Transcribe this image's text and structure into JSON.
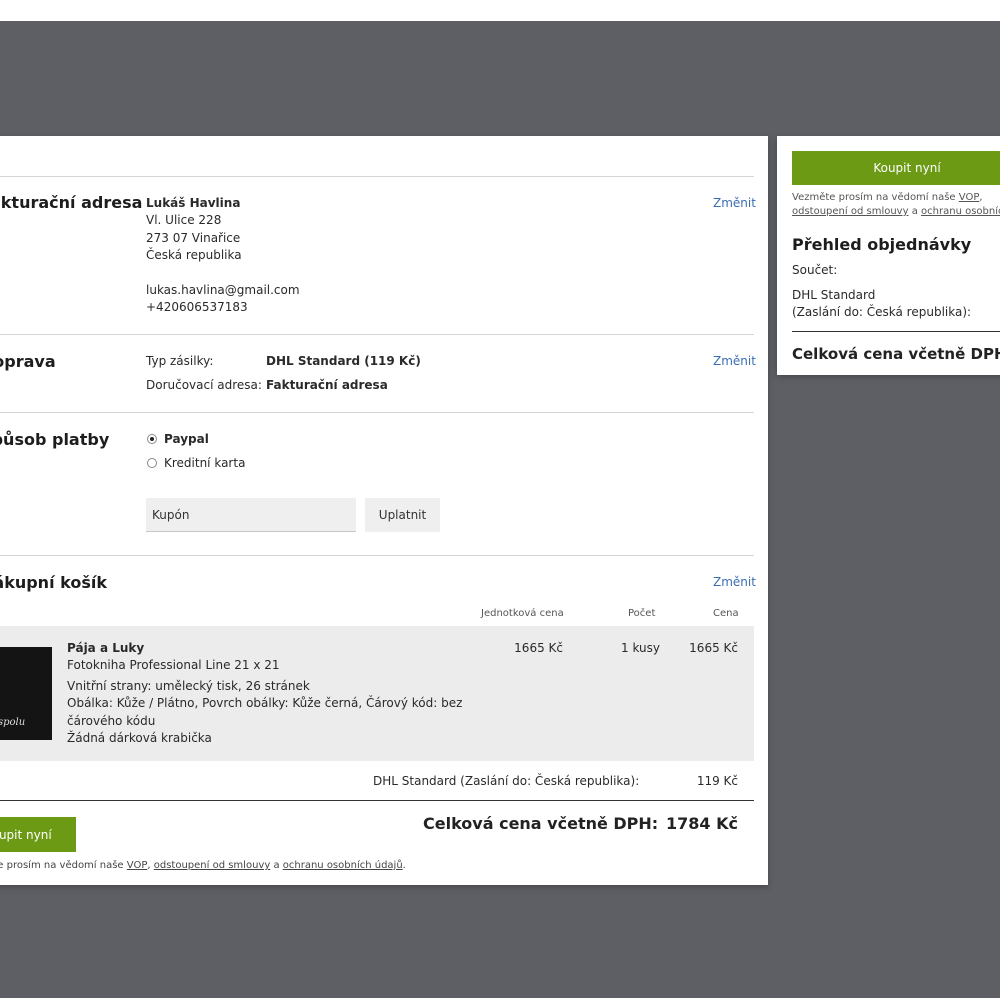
{
  "billing": {
    "title": "Fakturační adresa",
    "change": "Změnit",
    "name": "Lukáš Havlina",
    "street": "Vl. Ulice 228",
    "city": "273 07 Vinařice",
    "country": "Česká republika",
    "email": "lukas.havlina@gmail.com",
    "phone": "+420606537183"
  },
  "shipping": {
    "title": "Doprava",
    "change": "Změnit",
    "type_label": "Typ zásilky:",
    "type_value": "DHL Standard (119 Kč)",
    "address_label": "Doručovací adresa:",
    "address_value": "Fakturační adresa"
  },
  "payment": {
    "title": "Způsob platby",
    "options": [
      {
        "label": "Paypal",
        "selected": true
      },
      {
        "label": "Kreditní karta",
        "selected": false
      }
    ],
    "coupon_placeholder": "Kupón",
    "apply": "Uplatnit"
  },
  "cart": {
    "title": "Nákupní košík",
    "change": "Změnit",
    "headers": {
      "unit_price": "Jednotková cena",
      "count": "Počet",
      "price": "Cena"
    },
    "item": {
      "thumb_text": "spolu",
      "name": "Pája a Luky",
      "product": "Fotokniha Professional Line 21 x 21",
      "line1": "Vnitřní strany: umělecký tisk, 26 stránek",
      "line2": "Obálka: Kůže / Plátno, Povrch obálky: Kůže černá, Čárový kód: bez",
      "line3": "čárového kódu",
      "line4": "Žádná dárková krabička",
      "unit_price": "1665 Kč",
      "count": "1 kusy",
      "price": "1665 Kč"
    },
    "shipping_label": "DHL Standard (Zaslání do: Česká republika):",
    "shipping_price": "119 Kč",
    "total_label": "Celková cena včetně DPH:",
    "total": "1784 Kč"
  },
  "buy_label": "Koupit nyní",
  "terms": {
    "prefix": "Vezměte prosím na vědomí naše",
    "vop": "VOP",
    "comma": ",",
    "withdrawal": "odstoupení od smlouvy",
    "and": "a",
    "privacy": "ochranu osobních údajů",
    "end": "."
  },
  "summary": {
    "buy_label": "Koupit nyní",
    "title": "Přehled objednávky",
    "subtotal_label": "Součet:",
    "shipping_line1": "DHL Standard",
    "shipping_line2": "(Zaslání do: Česká republika):",
    "total_label": "Celková cena včetně DPH:"
  }
}
